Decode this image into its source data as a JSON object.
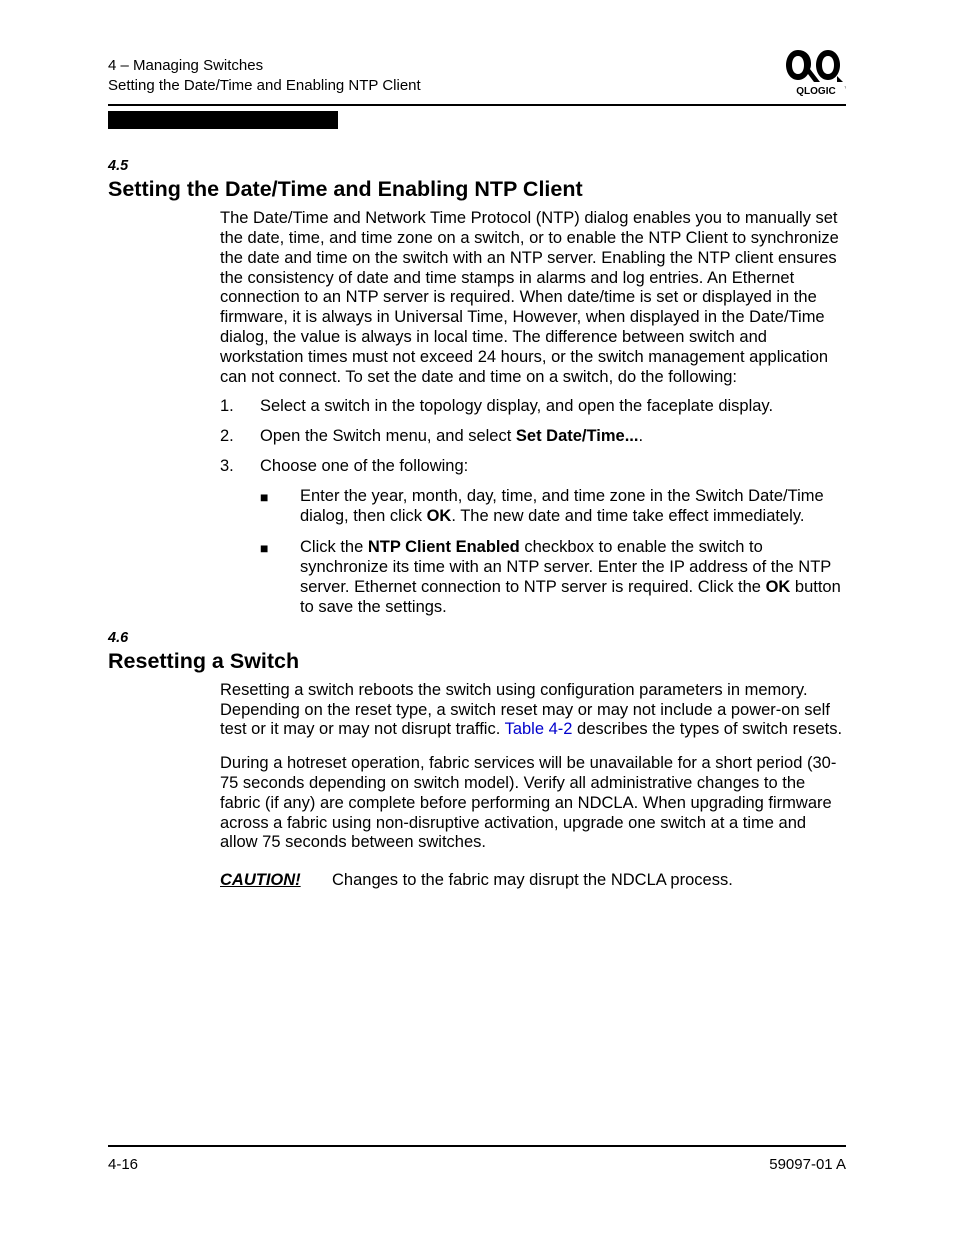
{
  "header": {
    "line1": "4 – Managing Switches",
    "line2": "Setting the Date/Time and Enabling NTP Client",
    "brand": "QLOGIC"
  },
  "sections": {
    "s45": {
      "num": "4.5",
      "title": "Setting the Date/Time and Enabling NTP Client",
      "intro": "The Date/Time and Network Time Protocol (NTP) dialog enables you to manually set the date, time, and time zone on a switch, or to enable the NTP Client to synchronize the date and time on the switch with an NTP server. Enabling the NTP client ensures the consistency of date and time stamps in alarms and log entries. An Ethernet connection to an NTP server is required. When date/time is set or displayed in the firmware, it is always in Universal Time, However, when displayed in the Date/Time dialog, the value is always in local time. The difference between switch and workstation times must not exceed 24 hours, or the switch management application can not connect. To set the date and time on a switch, do the following:",
      "step1": "Select a switch in the topology display, and open the faceplate display.",
      "step2_pre": "Open the Switch menu, and select ",
      "step2_bold": "Set Date/Time...",
      "step2_post": ".",
      "step3": "Choose one of the following:",
      "bullet1_a": "Enter the year, month, day, time, and time zone in the Switch Date/Time dialog, then click ",
      "bullet1_ok": "OK",
      "bullet1_b": ". The new date and time take effect immediately.",
      "bullet2_a": "Click the ",
      "bullet2_bold1": "NTP Client Enabled",
      "bullet2_b": " checkbox to enable the switch to synchronize its time with an NTP server. Enter the IP address of the NTP server. Ethernet connection to NTP server is required. Click the ",
      "bullet2_bold2": "OK",
      "bullet2_c": " button to save the settings."
    },
    "s46": {
      "num": "4.6",
      "title": "Resetting a Switch",
      "para1_a": "Resetting a switch reboots the switch using configuration parameters in memory. Depending on the reset type, a switch reset may or may not include a power-on self test or it may or may not disrupt traffic. ",
      "para1_link": "Table 4-2",
      "para1_b": " describes the types of switch resets.",
      "para2": "During a hotreset operation, fabric services will be unavailable for a short period (30-75 seconds depending on switch model). Verify all administrative changes to the fabric (if any) are complete before performing an NDCLA. When upgrading firmware across a fabric using non-disruptive activation, upgrade one switch at a time and allow 75 seconds between switches.",
      "caution_label": "CAUTION!",
      "caution_text": "Changes to the fabric may disrupt the NDCLA process."
    }
  },
  "footer": {
    "left": "4-16",
    "right": "59097-01 A"
  }
}
